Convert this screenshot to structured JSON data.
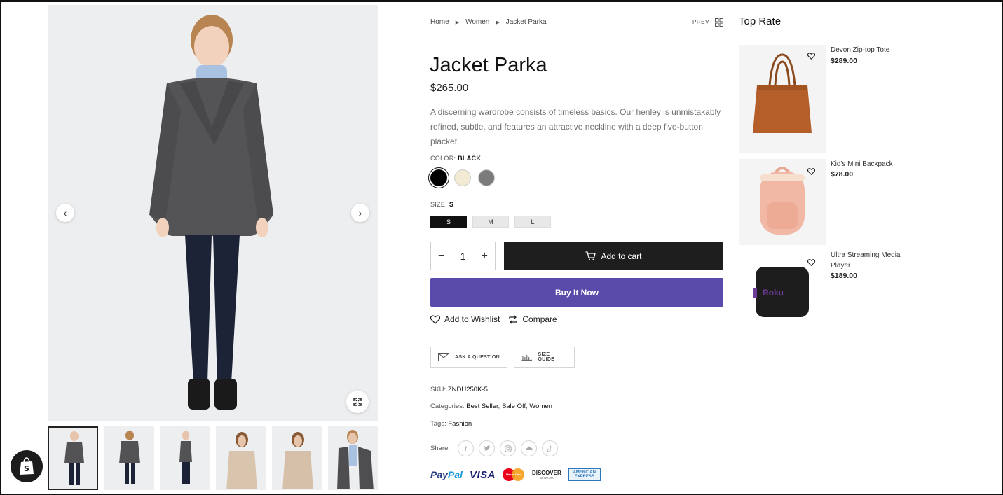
{
  "breadcrumb": {
    "home": "Home",
    "category": "Women",
    "current": "Jacket Parka"
  },
  "nav": {
    "prev": "PREV"
  },
  "product": {
    "title": "Jacket Parka",
    "price": "$265.00",
    "description": "A discerning wardrobe consists of timeless basics. Our henley is unmistakably refined, subtle, and features an attractive neckline with a deep five-button placket.",
    "color_label": "COLOR:",
    "color_value": "BLACK",
    "colors": [
      "#000000",
      "#f2ead2",
      "#7b7b7b"
    ],
    "size_label": "SIZE:",
    "size_value": "S",
    "sizes": [
      "S",
      "M",
      "L"
    ],
    "quantity": "1",
    "add_to_cart": "Add to cart",
    "buy_now": "Buy It Now",
    "add_to_wishlist": "Add to Wishlist",
    "compare": "Compare",
    "ask_question": "ASK A QUESTION",
    "size_guide": "SIZE GUIDE",
    "sku_label": "SKU:",
    "sku_value": "ZNDU250K-5",
    "categories_label": "Categories:",
    "categories": [
      "Best Seller",
      "Sale Off",
      "Women"
    ],
    "tags_label": "Tags:",
    "tags": [
      "Fashion"
    ],
    "share_label": "Share:",
    "share_icons": [
      "facebook-icon",
      "twitter-icon",
      "instagram-icon",
      "soundcloud-icon",
      "tiktok-icon"
    ],
    "payments": {
      "paypal_a": "Pay",
      "paypal_b": "Pal",
      "visa": "VISA",
      "mastercard": "MasterCard",
      "discover": "DISCOVER",
      "discover_sub": "NETWORK",
      "amex_a": "AMERICAN",
      "amex_b": "EXPRESS"
    }
  },
  "top_rate": {
    "title": "Top Rate",
    "items": [
      {
        "name": "Devon Zip-top Tote",
        "price": "$289.00"
      },
      {
        "name": "Kid's Mini Backpack",
        "price": "$78.00"
      },
      {
        "name": "Ultra Streaming Media Player",
        "price": "$189.00",
        "logo": "Roku"
      }
    ]
  },
  "colors": {
    "buy_now": "#5a4bab",
    "add_to_cart": "#1e1e1e"
  }
}
